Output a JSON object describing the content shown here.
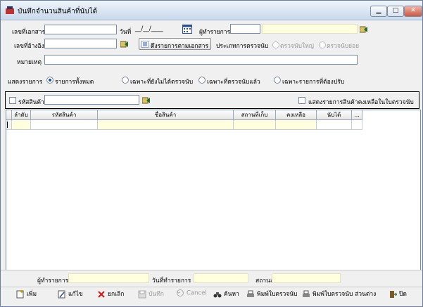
{
  "window": {
    "title": "บันทึกจำนวนสินค้าที่นับได้"
  },
  "header": {
    "doc_no_label": "เลขที่เอกสาร",
    "date_label": "วันที่",
    "date_value": "__/__/____",
    "maker_label": "ผู้ทำรายการ",
    "ref_no_label": "เลขที่อ้างอิง",
    "list_by_doc_button": "ดึงรายการตามเอกสาร",
    "count_type_label": "ประเภทการตรวจนับ",
    "count_type_options": [
      "ตรวจนับใหญ่",
      "ตรวจนับย่อย"
    ],
    "note_label": "หมายเหตุ"
  },
  "display": {
    "label": "แสดงรายการ",
    "options": [
      "รายการทั้งหมด",
      "เฉพาะที่ยังไม่ได้ตรวจนับ",
      "เฉพาะที่ตรวจนับแล้ว",
      "เฉพาะรายการที่ต้องปรับ"
    ],
    "selected": "รายการทั้งหมด"
  },
  "filter": {
    "product_code_label": "รหัสสินค้า",
    "show_remaining_label": "แสดงรายการสินค้าคงเหลือในใบตรวจนับ"
  },
  "grid": {
    "columns": [
      "ลำดับ",
      "รหัสสินค้า",
      "ชื่อสินค้า",
      "สถานที่เก็บ",
      "คงเหลือ",
      "นับได้",
      "..."
    ]
  },
  "footer": {
    "maker_label": "ผู้ทำรายการ",
    "make_date_label": "วันที่ทำรายการ",
    "status_label": "สถานะ"
  },
  "toolbar": {
    "add": "เพิ่ม",
    "edit": "แก้ไข",
    "cancel_doc": "ยกเลิก",
    "save": "บันทึก",
    "cancel": "Cancel",
    "search": "ค้นหา",
    "print_count": "พิมพ์ใบตรวจนับ",
    "print_count_diff": "พิมพ์ใบตรวจนับ ส่วนต่าง",
    "close": "ปิด"
  },
  "colors": {
    "readonly_bg": "#ffffe0",
    "title_bar": "#c9d8ec"
  }
}
